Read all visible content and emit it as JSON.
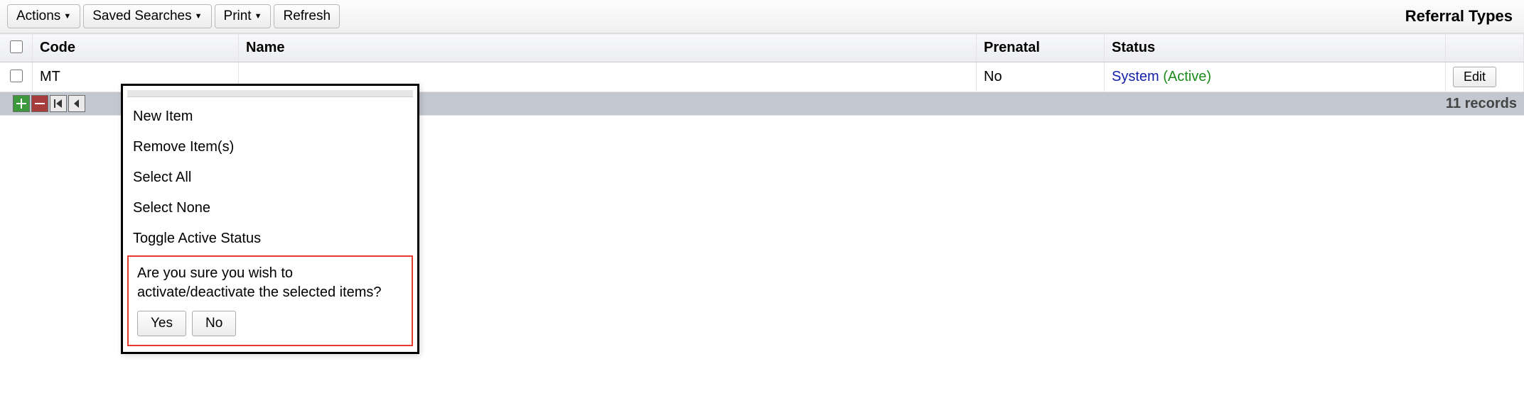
{
  "toolbar": {
    "actions_label": "Actions",
    "saved_searches_label": "Saved Searches",
    "print_label": "Print",
    "refresh_label": "Refresh",
    "page_title": "Referral Types"
  },
  "columns": {
    "code": "Code",
    "name": "Name",
    "prenatal": "Prenatal",
    "status": "Status"
  },
  "rows": [
    {
      "code": "MT",
      "name": "",
      "prenatal": "No",
      "status_system": "System",
      "status_active": "(Active)",
      "edit_label": "Edit"
    }
  ],
  "footer": {
    "count_label": "11 records"
  },
  "menu": {
    "new_item": "New Item",
    "remove_items": "Remove Item(s)",
    "select_all": "Select All",
    "select_none": "Select None",
    "toggle_active": "Toggle Active Status",
    "confirm_text": "Are you sure you wish to activate/deactivate the selected items?",
    "yes_label": "Yes",
    "no_label": "No"
  }
}
